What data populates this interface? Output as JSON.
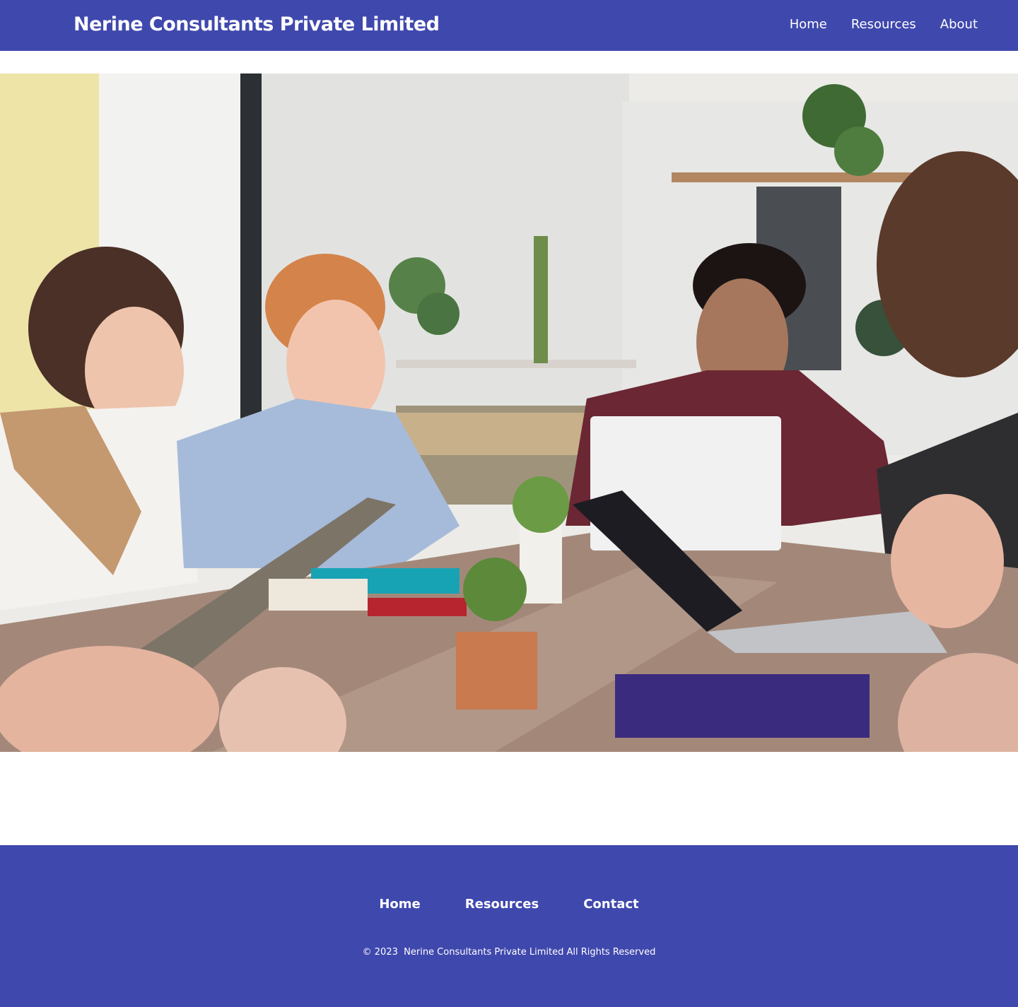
{
  "header": {
    "brand": "Nerine Consultants Private Limited",
    "nav": [
      "Home",
      "Resources",
      "About"
    ]
  },
  "hero": {
    "image": "team-meeting-photo",
    "background": "#e9e8e4"
  },
  "footer": {
    "nav": [
      "Home",
      "Resources",
      "Contact"
    ],
    "copyright": "© 2023  Nerine Consultants Private Limited All Rights Reserved"
  },
  "colors": {
    "primary": "#3f48ad",
    "text_on_primary": "#ffffff"
  },
  "icons": [
    "photo-illustration"
  ]
}
